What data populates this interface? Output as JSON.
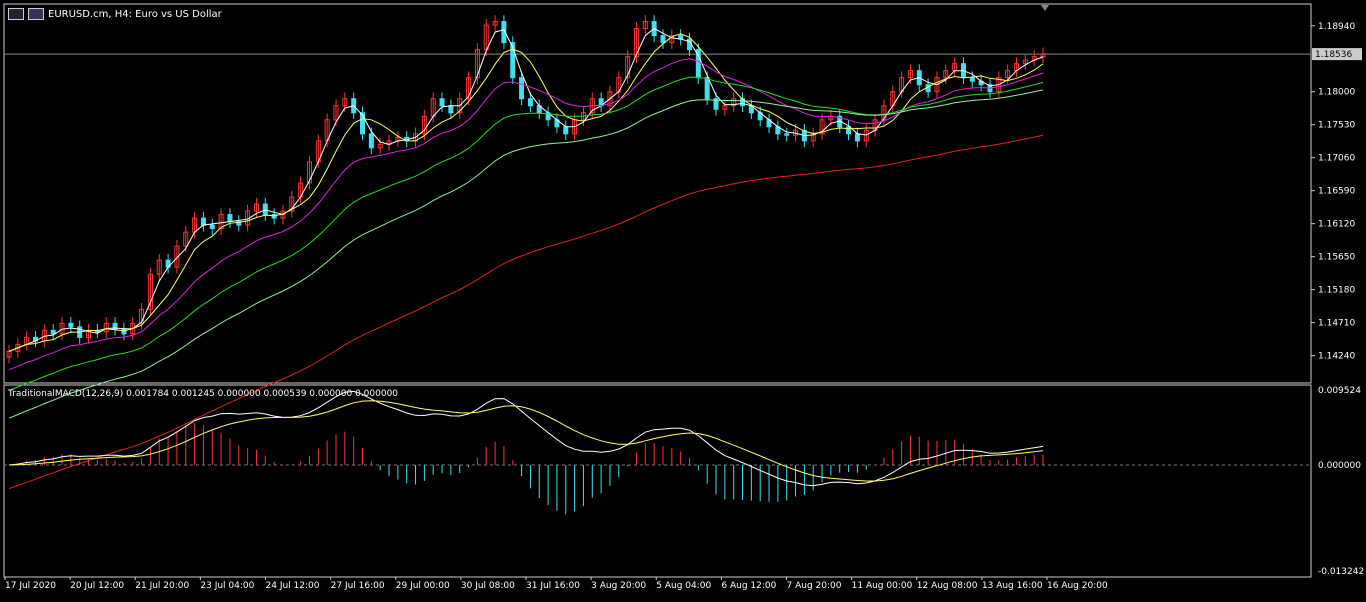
{
  "header": {
    "title": "EURUSD.cm, H4:  Euro vs US Dollar"
  },
  "indicator": {
    "label": "TraditionalMACD(12,26,9) 0.001784 0.001245 0.000000 0.000539 0.000000 0.000000"
  },
  "colors": {
    "background": "#000000",
    "bull_candle": "#ff3333",
    "bear_candle": "#3fe0f0",
    "ma_fast": "#ffffff",
    "ma_yellow": "#ffff66",
    "ma_magenta": "#e020e0",
    "ma_green": "#22dd22",
    "ma_lightgreen": "#99ee99",
    "ma_red": "#dd2222",
    "macd_main": "#ffffff",
    "macd_signal": "#ffff66",
    "hist_pos": "#ff3333",
    "hist_neg": "#3fe0f0"
  },
  "chart_data": {
    "type": "candlestick",
    "symbol": "EURUSD.cm",
    "timeframe": "H4",
    "price_axis_ticks": [
      "1.18940",
      "1.18000",
      "1.17530",
      "1.17060",
      "1.16590",
      "1.16120",
      "1.15650",
      "1.15180",
      "1.14710",
      "1.14240"
    ],
    "current_price_label": "1.18536",
    "ylim": [
      1.1385,
      1.1925
    ],
    "time_axis_labels": [
      "17 Jul 2020",
      "20 Jul 12:00",
      "21 Jul 20:00",
      "23 Jul 04:00",
      "24 Jul 12:00",
      "27 Jul 16:00",
      "29 Jul 00:00",
      "30 Jul 08:00",
      "31 Jul 16:00",
      "3 Aug 20:00",
      "5 Aug 04:00",
      "6 Aug 12:00",
      "7 Aug 20:00",
      "11 Aug 00:00",
      "12 Aug 08:00",
      "13 Aug 16:00",
      "16 Aug 20:00"
    ],
    "closes": [
      1.143,
      1.144,
      1.145,
      1.1445,
      1.146,
      1.1455,
      1.147,
      1.1465,
      1.145,
      1.146,
      1.1458,
      1.147,
      1.1462,
      1.1455,
      1.147,
      1.149,
      1.154,
      1.156,
      1.155,
      1.158,
      1.16,
      1.162,
      1.161,
      1.1605,
      1.1625,
      1.1615,
      1.161,
      1.163,
      1.164,
      1.1625,
      1.162,
      1.163,
      1.165,
      1.167,
      1.17,
      1.173,
      1.176,
      1.178,
      1.179,
      1.177,
      1.174,
      1.172,
      1.1725,
      1.173,
      1.1735,
      1.173,
      1.174,
      1.1765,
      1.179,
      1.178,
      1.177,
      1.179,
      1.182,
      1.186,
      1.1895,
      1.19,
      1.187,
      1.182,
      1.179,
      1.178,
      1.177,
      1.176,
      1.175,
      1.174,
      1.176,
      1.177,
      1.179,
      1.178,
      1.18,
      1.182,
      1.185,
      1.189,
      1.19,
      1.188,
      1.187,
      1.188,
      1.1875,
      1.186,
      1.182,
      1.179,
      1.1775,
      1.178,
      1.179,
      1.178,
      1.177,
      1.176,
      1.175,
      1.174,
      1.1738,
      1.1745,
      1.173,
      1.174,
      1.176,
      1.1765,
      1.175,
      1.174,
      1.173,
      1.1745,
      1.176,
      1.178,
      1.18,
      1.182,
      1.183,
      1.181,
      1.18,
      1.182,
      1.183,
      1.184,
      1.182,
      1.1815,
      1.181,
      1.18,
      1.182,
      1.183,
      1.184,
      1.1845,
      1.185,
      1.1854
    ]
  }
}
